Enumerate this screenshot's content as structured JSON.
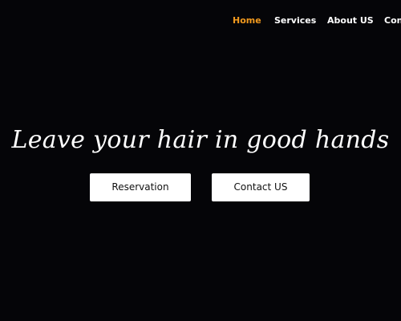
{
  "nav": {
    "items": [
      {
        "label": "Home",
        "active": true
      },
      {
        "label": "Services",
        "active": false
      },
      {
        "label": "About US",
        "active": false
      },
      {
        "label": "Contact US",
        "active": false
      }
    ],
    "active_color": "#f29a1e",
    "text_color": "#ffffff"
  },
  "hero": {
    "title": "Leave your hair in good hands",
    "buttons": {
      "reservation_label": "Reservation",
      "contact_label": "Contact US"
    }
  },
  "colors": {
    "background": "#050508",
    "button_background": "#ffffff",
    "button_text": "#111111"
  }
}
